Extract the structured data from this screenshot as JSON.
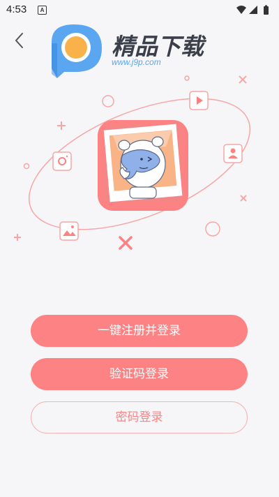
{
  "status_bar": {
    "time": "4:53",
    "notification_badge": "A",
    "icons": [
      "wifi-icon",
      "signal-icon",
      "battery-icon"
    ]
  },
  "header": {
    "back_icon": "chevron-left-icon",
    "brand_name": "精品下载",
    "brand_url": "www.j9p.com"
  },
  "illustration": {
    "icons": [
      "play-icon",
      "user-icon",
      "camera-icon",
      "image-icon"
    ],
    "center_image": "mascot-photo-frame"
  },
  "actions": {
    "one_click_register": "一键注册并登录",
    "sms_login": "验证码登录",
    "password_login": "密码登录"
  },
  "colors": {
    "accent": "#fc8283",
    "outline_border": "#f5b3b3",
    "background": "#f6f5f7",
    "logo_blue": "#5aa6f0",
    "logo_orange": "#f9b24a"
  }
}
